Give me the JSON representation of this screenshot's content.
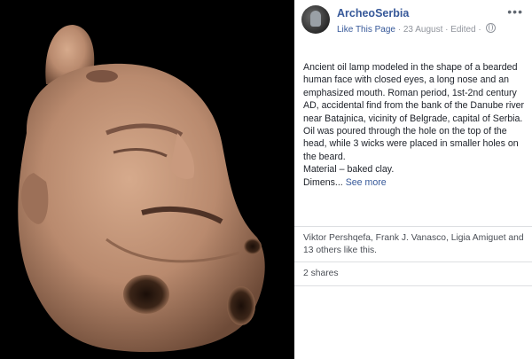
{
  "post": {
    "page_name": "ArcheoSerbia",
    "like_page": "Like This Page",
    "separator": "·",
    "date": "23 August",
    "edited": "Edited",
    "more_menu": "•••",
    "text_lines": [
      "Ancient oil lamp modeled in the shape of a bearded human face with closed eyes, a long nose and an emphasized mouth. Roman period, 1st-2nd century AD, accidental find from the bank of the Danube river near Batajnica, vicinity of Belgrade, capital of Serbia.",
      "Oil was poured through the hole on the top of the head, while 3 wicks were placed in smaller holes on the beard.",
      "Material – baked clay."
    ],
    "truncated_text": "Dimens...",
    "see_more": "See more",
    "likes_text": "Viktor Pershqefa, Frank J. Vanasco, Ligia Amiguet and 13 others like this.",
    "shares_text": "2 shares",
    "privacy_icon": "globe-icon",
    "photo_description_icon": "oil-lamp-photo"
  },
  "colors": {
    "link": "#365899",
    "meta": "#90949c",
    "text": "#1d2129",
    "photo_background": "#000000",
    "clay": "#b98a6e"
  }
}
